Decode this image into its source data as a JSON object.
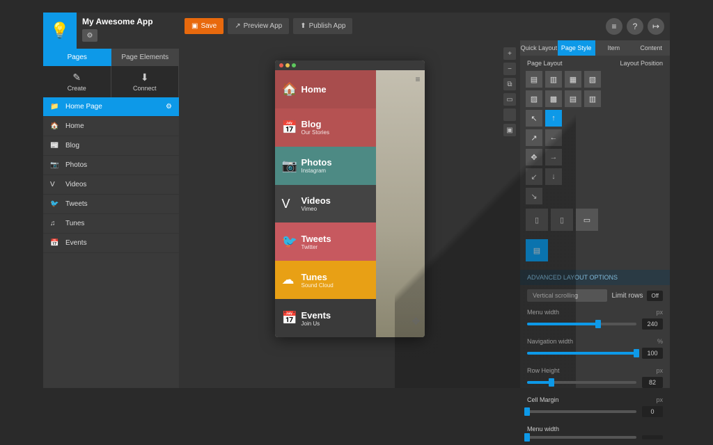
{
  "app_name": "My Awesome App",
  "sidebar": {
    "tabs": [
      {
        "label": "Pages",
        "active": true
      },
      {
        "label": "Page Elements",
        "active": false
      }
    ],
    "actions": [
      {
        "label": "Create",
        "icon": "✎"
      },
      {
        "label": "Connect",
        "icon": "⬇"
      }
    ],
    "pages": [
      {
        "label": "Home Page",
        "icon": "📁",
        "selected": true
      },
      {
        "label": "Home",
        "icon": "🏠",
        "selected": false
      },
      {
        "label": "Blog",
        "icon": "📰",
        "selected": false
      },
      {
        "label": "Photos",
        "icon": "📷",
        "selected": false
      },
      {
        "label": "Videos",
        "icon": "V",
        "selected": false
      },
      {
        "label": "Tweets",
        "icon": "🐦",
        "selected": false
      },
      {
        "label": "Tunes",
        "icon": "♫",
        "selected": false
      },
      {
        "label": "Events",
        "icon": "📅",
        "selected": false
      }
    ]
  },
  "toolbar": {
    "save": "Save",
    "preview": "Preview App",
    "publish": "Publish App"
  },
  "phone_menu": [
    {
      "title": "Home",
      "sub": "",
      "icon": "🏠",
      "color": "#a84d4d"
    },
    {
      "title": "Blog",
      "sub": "Our Stories",
      "icon": "📅",
      "color": "#b55252"
    },
    {
      "title": "Photos",
      "sub": "Instagram",
      "icon": "📷",
      "color": "#4d8a84"
    },
    {
      "title": "Videos",
      "sub": "Vimeo",
      "icon": "V",
      "color": "#444444"
    },
    {
      "title": "Tweets",
      "sub": "Twitter",
      "icon": "🐦",
      "color": "#c7595f"
    },
    {
      "title": "Tunes",
      "sub": "Sound Cloud",
      "icon": "☁",
      "color": "#e8a015"
    },
    {
      "title": "Events",
      "sub": "Join Us",
      "icon": "📅",
      "color": "#3a3a3a"
    }
  ],
  "right": {
    "tabs": [
      {
        "label": "Quick Layout",
        "active": false
      },
      {
        "label": "Page Style",
        "active": true
      },
      {
        "label": "Item",
        "active": false
      },
      {
        "label": "Content",
        "active": false
      }
    ],
    "section1": "Page Layout",
    "section2": "Layout Position",
    "adv_header": "ADVANCED LAYOUT OPTIONS",
    "scroll_label": "Vertical scrolling",
    "limit_rows_label": "Limit rows",
    "limit_rows_value": "Off",
    "sliders": [
      {
        "label": "Menu width",
        "unit": "px",
        "value": "240",
        "pct": 65
      },
      {
        "label": "Navigation width",
        "unit": "%",
        "value": "100",
        "pct": 100
      },
      {
        "label": "Row Height",
        "unit": "px",
        "value": "82",
        "pct": 22
      },
      {
        "label": "Cell Margin",
        "unit": "px",
        "value": "0",
        "pct": 0
      },
      {
        "label": "Menu width",
        "unit": "",
        "value": "",
        "pct": 0
      }
    ]
  }
}
